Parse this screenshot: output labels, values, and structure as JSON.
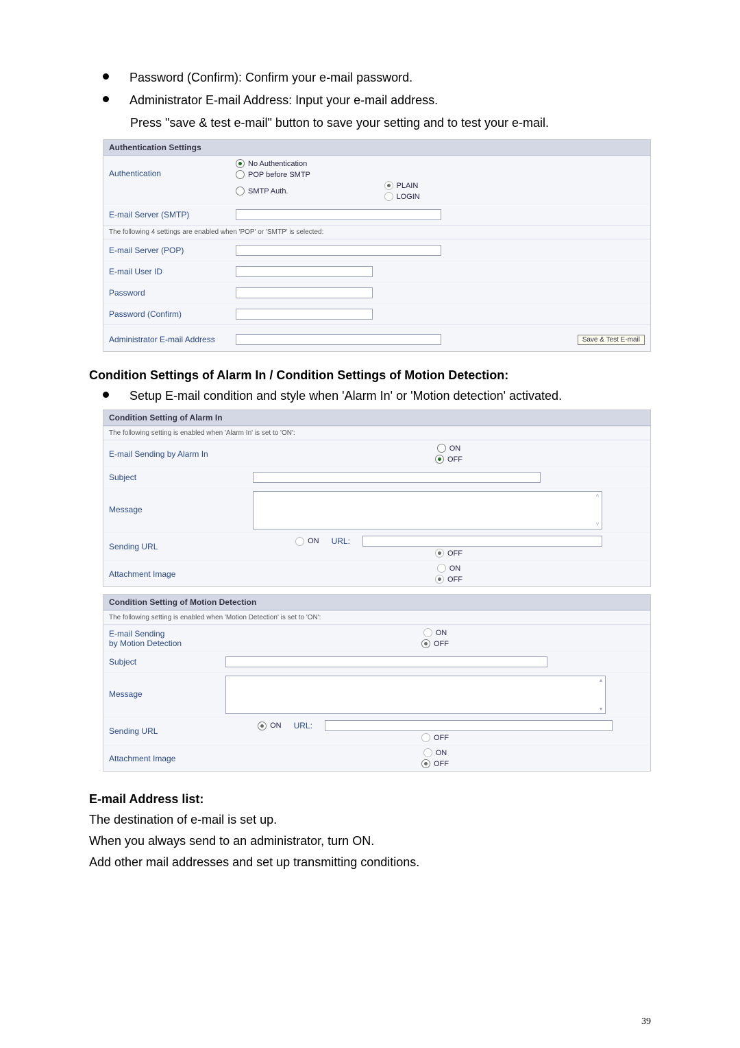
{
  "bullets_top": [
    "Password (Confirm): Confirm your e-mail password.",
    "Administrator E-mail Address: Input your e-mail address."
  ],
  "indent_top": "Press \"save & test e-mail\" button to save your setting and to test your e-mail.",
  "auth_box": {
    "header": "Authentication Settings",
    "row_auth_label": "Authentication",
    "opt_noauth": "No Authentication",
    "opt_popbefore": "POP before SMTP",
    "opt_smtpauth": "SMTP Auth.",
    "opt_plain": "PLAIN",
    "opt_login": "LOGIN",
    "row_smtp_label": "E-mail Server (SMTP)",
    "note_4settings": "The following 4 settings are enabled when 'POP' or 'SMTP' is selected:",
    "row_pop_label": "E-mail Server (POP)",
    "row_userid_label": "E-mail User ID",
    "row_pw_label": "Password",
    "row_pwconf_label": "Password (Confirm)",
    "row_admin_label": "Administrator E-mail Address",
    "btn_save": "Save & Test E-mail"
  },
  "section_condition_title": "Condition Settings of Alarm In / Condition Settings of Motion Detection:",
  "bullets_mid": [
    "Setup E-mail condition and style when 'Alarm In' or 'Motion detection' activated."
  ],
  "alarm_box": {
    "header": "Condition Setting of Alarm In",
    "note": "The following setting is enabled when 'Alarm In' is set to 'ON':",
    "row_sending_label": "E-mail Sending by Alarm In",
    "on": "ON",
    "off": "OFF",
    "row_subject_label": "Subject",
    "row_message_label": "Message",
    "row_url_label": "Sending URL",
    "url_field_label": "URL:",
    "row_attach_label": "Attachment Image"
  },
  "motion_box": {
    "header": "Condition Setting of Motion Detection",
    "note": "The following setting is enabled when 'Motion Detection' is set to 'ON':",
    "row_sending_label_1": "E-mail Sending",
    "row_sending_label_2": "by Motion Detection",
    "on": "ON",
    "off": "OFF",
    "row_subject_label": "Subject",
    "row_message_label": "Message",
    "row_url_label": "Sending URL",
    "url_field_label": "URL:",
    "row_attach_label": "Attachment Image"
  },
  "section_email_list_title": "E-mail Address list:",
  "body_lines": [
    "The destination of e-mail is set up.",
    "When you always send to an administrator, turn ON.",
    "Add other mail addresses and set up transmitting conditions."
  ],
  "page_number": "39"
}
